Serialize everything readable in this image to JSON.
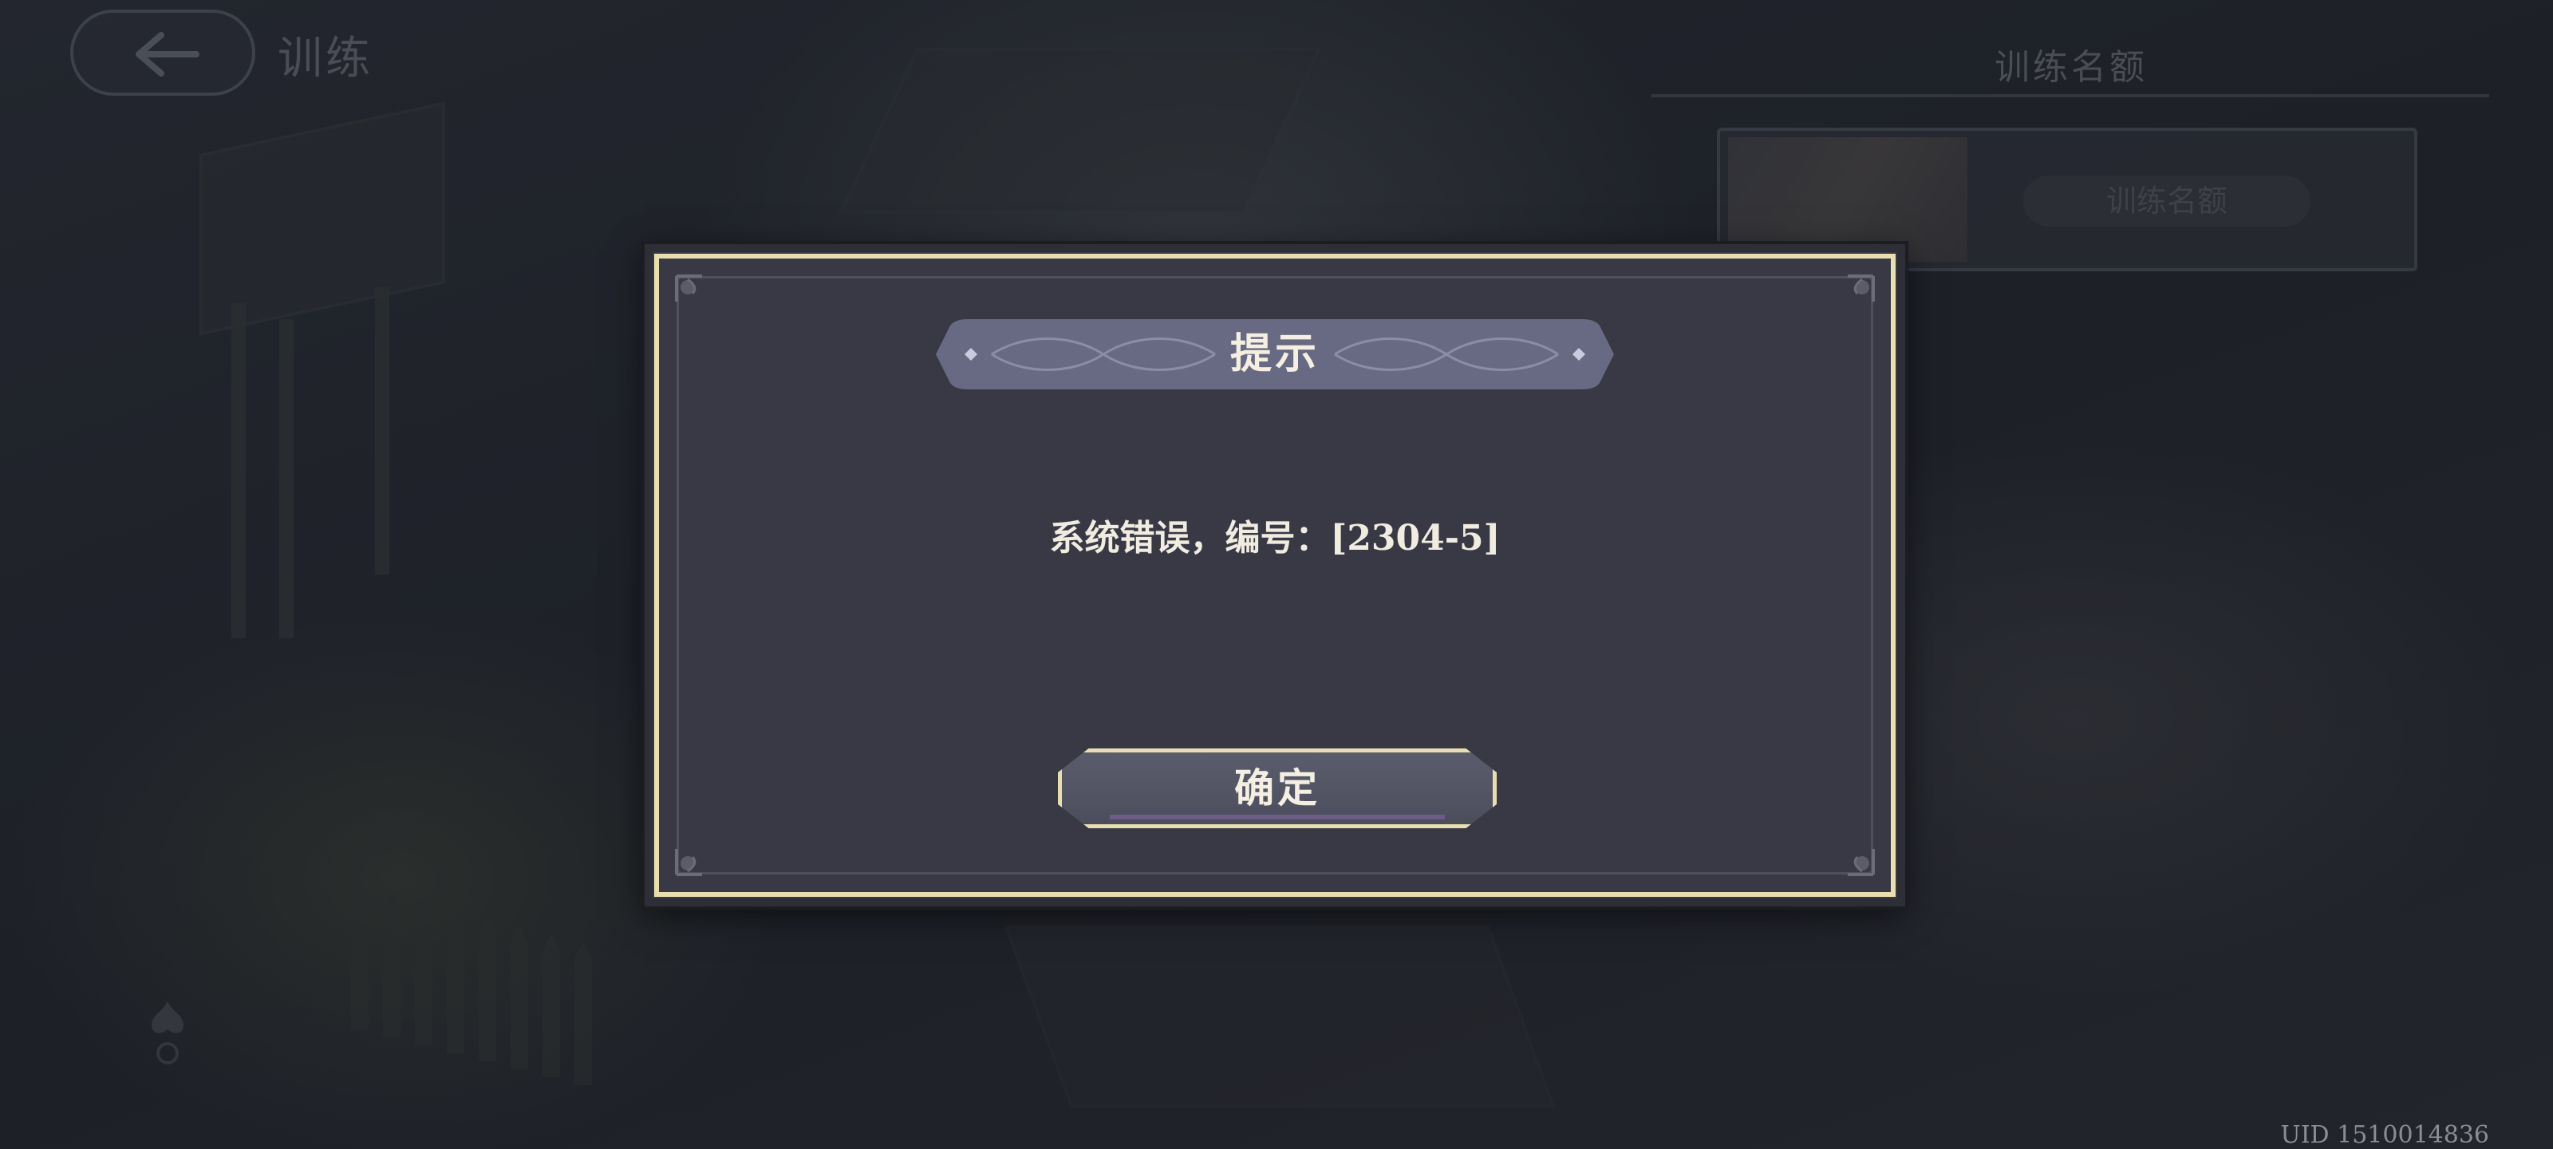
{
  "header": {
    "page_title": "训练"
  },
  "rank_panel": {
    "title": "训练名额",
    "badge": "训练名额"
  },
  "dialog": {
    "title": "提示",
    "message": "系统错误，编号：[2304-5]",
    "confirm_label": "确定"
  },
  "footer": {
    "uid": "UID 1510014836"
  },
  "colors": {
    "dialog_bg": "#383945",
    "dialog_border_gold": "#e9dfae",
    "text_light": "#f4efe0",
    "title_bar": "#6a6e86"
  },
  "icons": {
    "back": "arrow-left-icon",
    "corner": "fleur-corner-icon"
  }
}
